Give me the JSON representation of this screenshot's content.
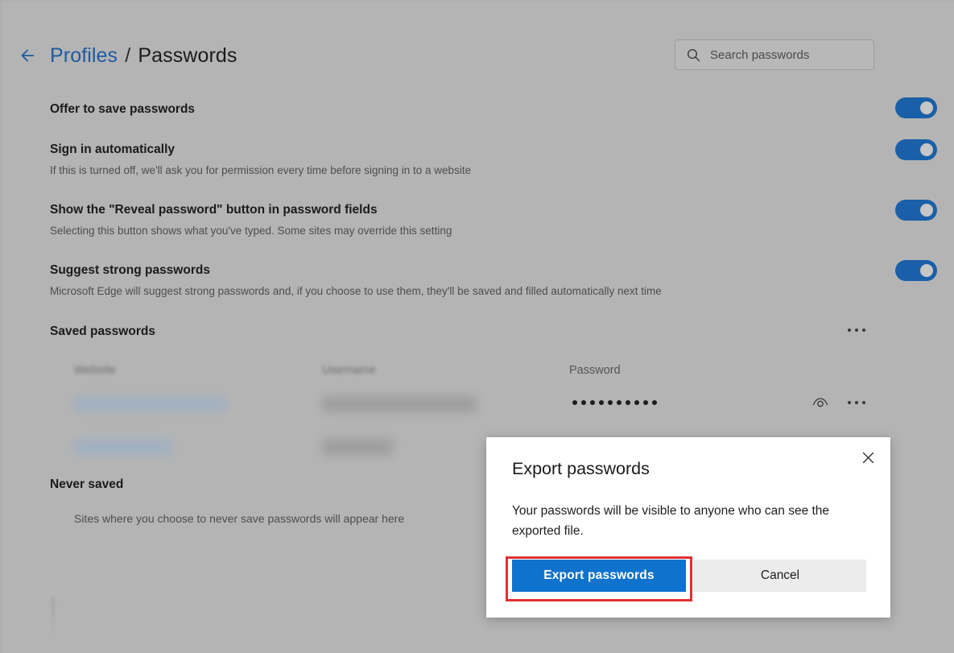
{
  "header": {
    "back_icon": "back-arrow-icon",
    "breadcrumb_parent": "Profiles",
    "breadcrumb_separator": "/",
    "breadcrumb_current": "Passwords"
  },
  "search": {
    "icon": "search-icon",
    "placeholder": "Search passwords",
    "value": ""
  },
  "settings": [
    {
      "title": "Offer to save passwords",
      "description": "",
      "toggle_on": true
    },
    {
      "title": "Sign in automatically",
      "description": "If this is turned off, we'll ask you for permission every time before signing in to a website",
      "toggle_on": true
    },
    {
      "title": "Show the \"Reveal password\" button in password fields",
      "description": "Selecting this button shows what you've typed. Some sites may override this setting",
      "toggle_on": true
    },
    {
      "title": "Suggest strong passwords",
      "description": "Microsoft Edge will suggest strong passwords and, if you choose to use them, they'll be saved and filled automatically next time",
      "toggle_on": true
    }
  ],
  "saved_passwords": {
    "heading": "Saved passwords",
    "more_options_icon": "ellipsis-icon",
    "columns": [
      "Website",
      "Username",
      "Password"
    ],
    "rows": [
      {
        "website": "",
        "username": "",
        "password_masked": "••••••••••",
        "reveal_icon": "eye-icon",
        "row_more_icon": "ellipsis-icon"
      },
      {
        "website": "",
        "username": "",
        "password_masked": "",
        "reveal_icon": "",
        "row_more_icon": ""
      }
    ]
  },
  "never_saved": {
    "heading": "Never saved",
    "empty_text": "Sites where you choose to never save passwords will appear here"
  },
  "dialog": {
    "title": "Export passwords",
    "body": "Your passwords will be visible to anyone who can see the exported file.",
    "confirm_label": "Export passwords",
    "cancel_label": "Cancel",
    "close_icon": "close-icon"
  },
  "colors": {
    "page_background": "#b4b4b4",
    "accent_link": "#1f5aa0",
    "toggle_on": "#1a5fa8",
    "primary_button": "#0f73ce",
    "secondary_button": "#ececec",
    "highlight_outline": "#e03131",
    "dialog_background": "#ffffff"
  }
}
